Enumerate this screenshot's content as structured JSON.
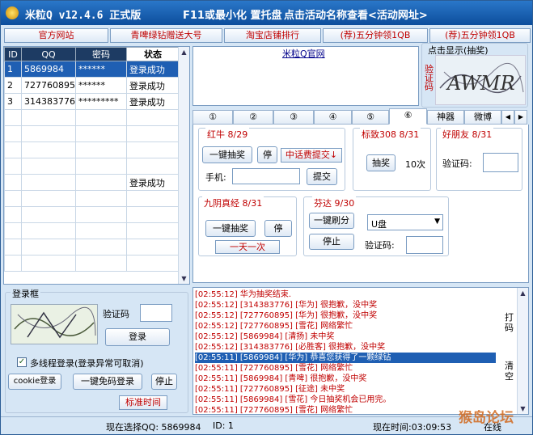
{
  "title": {
    "app": "米粒Q v12.4.6 正式版",
    "hint1": "F11或最小化 置托盘",
    "hint2": "点击活动名称查看<活动网址>"
  },
  "top_buttons": [
    "官方网站",
    "青啤绿钻赠送大号",
    "淘宝店铺排行",
    "(荐)五分钟领1QB",
    "(荐)五分钟领1QB"
  ],
  "accounts": {
    "headers": [
      "ID",
      "QQ",
      "密码",
      "状态"
    ],
    "rows": [
      {
        "id": "1",
        "qq": "5869984",
        "pwd": "******",
        "status": "登录成功"
      },
      {
        "id": "2",
        "qq": "727760895",
        "pwd": "******",
        "status": "登录成功"
      },
      {
        "id": "3",
        "qq": "314383776",
        "pwd": "*********",
        "status": "登录成功"
      },
      {
        "id": "",
        "qq": "",
        "pwd": "",
        "status": ""
      },
      {
        "id": "",
        "qq": "",
        "pwd": "",
        "status": ""
      },
      {
        "id": "",
        "qq": "",
        "pwd": "",
        "status": ""
      },
      {
        "id": "",
        "qq": "",
        "pwd": "",
        "status": ""
      },
      {
        "id": "",
        "qq": "",
        "pwd": "",
        "status": "登录成功"
      },
      {
        "id": "",
        "qq": "",
        "pwd": "",
        "status": ""
      },
      {
        "id": "",
        "qq": "",
        "pwd": "",
        "status": ""
      },
      {
        "id": "",
        "qq": "",
        "pwd": "",
        "status": ""
      },
      {
        "id": "",
        "qq": "",
        "pwd": "",
        "status": ""
      },
      {
        "id": "",
        "qq": "",
        "pwd": "",
        "status": ""
      }
    ]
  },
  "website_link": "米粒Q官网",
  "captcha_box": {
    "label": "点击显示(抽奖)",
    "side_label": "验证码",
    "captcha_text": "AWMR"
  },
  "tabs": [
    "①",
    "②",
    "③",
    "④",
    "⑤",
    "⑥",
    "神器",
    "微博"
  ],
  "active_tab": 5,
  "group_hongniu": {
    "title": "红牛 8/29",
    "draw_btn": "一键抽奖",
    "stop_btn": "停",
    "charge_btn": "中话费提交↓",
    "phone_label": "手机:",
    "phone_value": "",
    "submit_btn": "提交"
  },
  "group_biaozhi": {
    "title": "标致308 8/31",
    "draw_btn": "抽奖",
    "times": "10次"
  },
  "group_haopengyou": {
    "title": "好朋友 8/31",
    "captcha_label": "验证码:"
  },
  "group_jiuyin": {
    "title": "九阴真经 8/31",
    "draw_btn": "一键抽奖",
    "stop_btn": "停",
    "note": "一天一次"
  },
  "group_fenda": {
    "title": "芬达 9/30",
    "refresh_btn": "一键刷分",
    "select_value": "U盘",
    "stop_btn": "停止",
    "captcha_label": "验证码:"
  },
  "login_box": {
    "title": "登录框",
    "captcha_label": "验证码",
    "login_btn": "登录",
    "multithread_label": "多线程登录(登录异常可取消)",
    "multithread_checked": true,
    "cookie_btn": "cookie登录",
    "nocaptcha_btn": "一键免码登录",
    "stop_btn": "停止",
    "std_time_btn": "标准时间"
  },
  "log": [
    {
      "text": "[02:55:12] 华为抽奖结束.",
      "hl": false
    },
    {
      "text": "[02:55:12] [314383776] [华为] 很抱歉，没中奖",
      "hl": false
    },
    {
      "text": "[02:55:12] [727760895] [华为] 很抱歉，没中奖",
      "hl": false
    },
    {
      "text": "[02:55:12] [727760895] [雪花] 网络繁忙",
      "hl": false
    },
    {
      "text": "[02:55:12] [5869984] [清扬] 未中奖",
      "hl": false
    },
    {
      "text": "[02:55:12] [314383776] [必胜客] 很抱歉，没中奖",
      "hl": false
    },
    {
      "text": "[02:55:11] [5869984] [华为] 恭喜您获得了一颗绿钻",
      "hl": true
    },
    {
      "text": "[02:55:11] [727760895] [雪花] 网络繁忙",
      "hl": false
    },
    {
      "text": "[02:55:11] [5869984] [青啤] 很抱歉，没中奖",
      "hl": false
    },
    {
      "text": "[02:55:11] [727760895] [征途] 未中奖",
      "hl": false
    },
    {
      "text": "[02:55:11] [5869984] [雪花] 今日抽奖机会已用完。",
      "hl": false
    },
    {
      "text": "[02:55:11] [727760895] [雪花] 网络繁忙",
      "hl": false
    }
  ],
  "log_side_buttons": {
    "print": "打码",
    "clear": "清空"
  },
  "status": {
    "selected": "现在选择QQ: 5869984",
    "id": "ID: 1",
    "time": "现在时间:03:09:53",
    "mode": "在线",
    "watermark": "猴岛论坛"
  }
}
